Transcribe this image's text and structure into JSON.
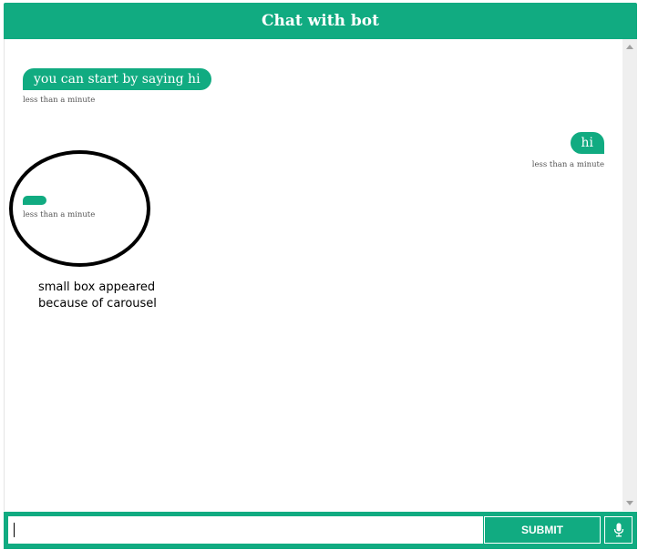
{
  "header": {
    "title": "Chat with bot"
  },
  "messages": [
    {
      "sender": "bot",
      "text": "you can start by saying hi",
      "time": "less than a minute"
    },
    {
      "sender": "user",
      "text": "hi",
      "time": "less than a minute"
    },
    {
      "sender": "bot",
      "text": "",
      "time": "less than a minute"
    }
  ],
  "annotation": {
    "line1": "small box appeared",
    "line2": "because of carousel"
  },
  "input": {
    "value": "",
    "placeholder": ""
  },
  "submit": {
    "label": "SUBMIT"
  },
  "mic": {
    "icon": "microphone-icon"
  },
  "colors": {
    "accent": "#11ab81",
    "annotation": "#000000"
  }
}
